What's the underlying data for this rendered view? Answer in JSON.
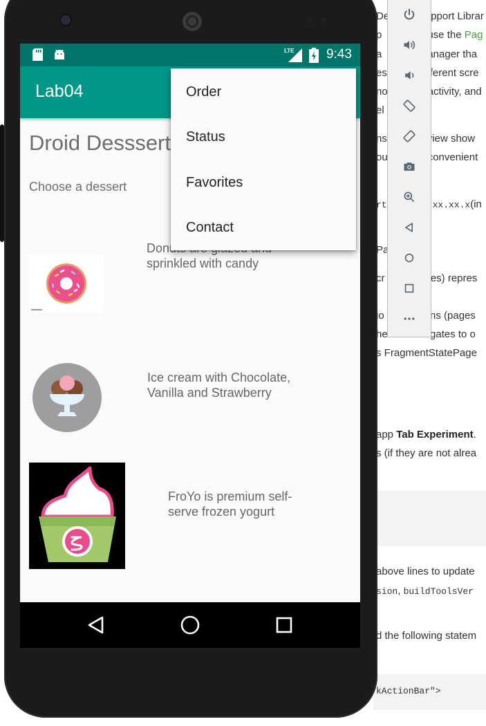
{
  "background_doc": {
    "lines": [
      {
        "text": "De",
        "text2": "pport Librar"
      },
      {
        "text": "p",
        "text2": "use the ",
        "green": "Pag"
      },
      {
        "text": "a",
        "text2": "anager tha"
      },
      {
        "text": "es",
        "text2": "fferent scre"
      },
      {
        "text": "no",
        "text2": "activity, and"
      },
      {
        "text": "el",
        "text2": ""
      },
      {
        "text": "ns",
        "text2": "view show"
      },
      {
        "text": "ou",
        "text2": "convenient"
      },
      {
        "text": "rt",
        "text2": "xx.xx.x",
        "text3": "(in"
      },
      {
        "text": "Pa",
        "text2": ""
      },
      {
        "text": "cr",
        "text2": "ges) repres"
      },
      {
        "text": "io",
        "text2": "ens (pages"
      },
      {
        "text": "he",
        "text2": "igates to o"
      },
      {
        "text": "s FragmentStatePage"
      },
      {
        "text": "app ",
        "bold": "Tab Experiment",
        "text2": "."
      },
      {
        "text": "s (if they are not alrea"
      },
      {
        "text": "above lines to update"
      },
      {
        "text": "sion",
        "text2": ", ",
        "mono2": "buildToolsVer"
      },
      {
        "text": "d the following statem"
      },
      {
        "text": "kActionBar\">"
      }
    ]
  },
  "toolbar": {
    "buttons": [
      "power-icon",
      "volume-up-icon",
      "volume-down-icon",
      "rotate-left-icon",
      "rotate-right-icon",
      "camera-icon",
      "zoom-icon",
      "back-icon",
      "home-icon",
      "overview-icon",
      "more-icon"
    ]
  },
  "status_bar": {
    "time": "9:43",
    "network": "LTE"
  },
  "app_bar": {
    "title": "Lab04"
  },
  "content": {
    "title": "Droid Desssert",
    "subtitle": "Choose a dessert",
    "items": [
      {
        "name": "donut",
        "description": "Donuts are glazed and\nsprinkled with candy"
      },
      {
        "name": "ice-cream",
        "description": "Ice cream with Chocolate,\nVanilla and Strawberry"
      },
      {
        "name": "froyo",
        "description": "FroYo is premium self-\nserve frozen yogurt"
      }
    ]
  },
  "menu": {
    "items": [
      "Order",
      "Status",
      "Favorites",
      "Contact"
    ]
  },
  "colors": {
    "primary": "#009688",
    "primary_dark": "#00766a",
    "text_secondary": "#6d6d6d"
  }
}
